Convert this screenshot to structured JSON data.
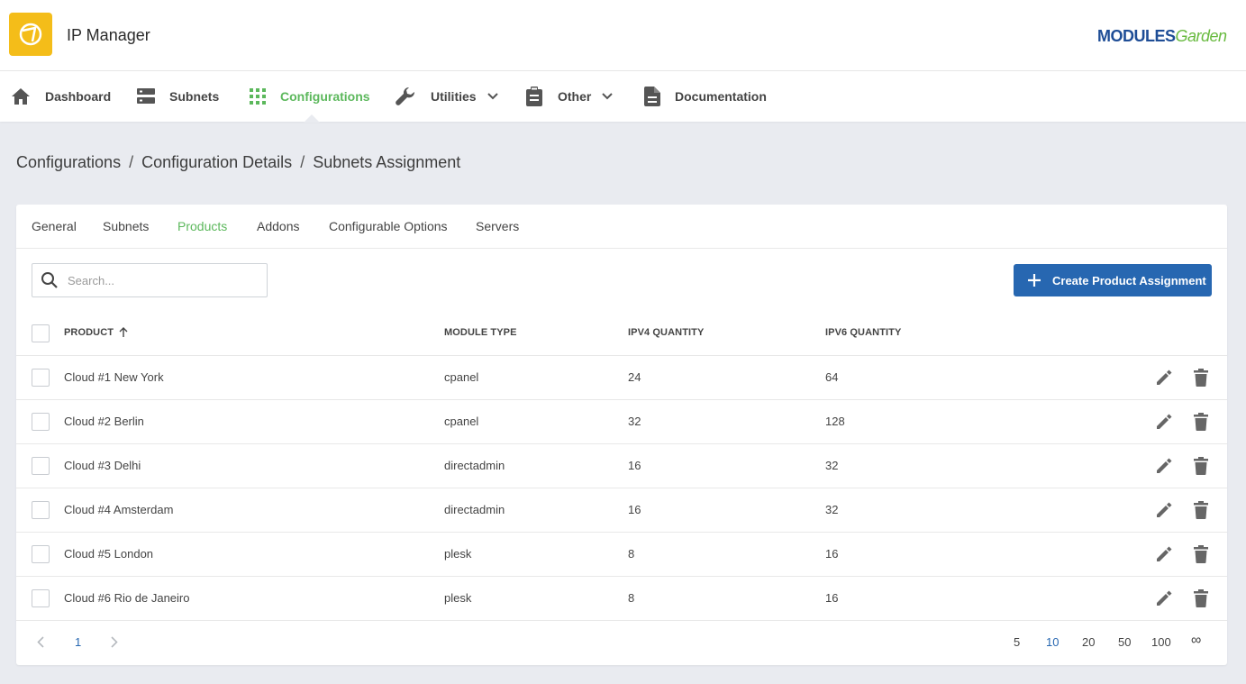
{
  "app": {
    "title": "IP Manager",
    "brand_bold": "MODULES",
    "brand_light": "Garden"
  },
  "nav": {
    "dashboard": "Dashboard",
    "subnets": "Subnets",
    "configurations": "Configurations",
    "utilities": "Utilities",
    "other": "Other",
    "documentation": "Documentation"
  },
  "breadcrumb": {
    "c1": "Configurations",
    "c2": "Configuration Details",
    "c3": "Subnets Assignment",
    "sep": "/"
  },
  "tabs": {
    "general": "General",
    "subnets": "Subnets",
    "products": "Products",
    "addons": "Addons",
    "configurable_options": "Configurable Options",
    "servers": "Servers"
  },
  "search": {
    "placeholder": "Search..."
  },
  "create_button": "Create Product Assignment",
  "table": {
    "headers": {
      "product": "PRODUCT",
      "module_type": "MODULE TYPE",
      "ipv4": "IPV4 QUANTITY",
      "ipv6": "IPV6 QUANTITY"
    },
    "rows": [
      {
        "product": "Cloud #1 New York",
        "module_type": "cpanel",
        "ipv4": "24",
        "ipv6": "64"
      },
      {
        "product": "Cloud #2 Berlin",
        "module_type": "cpanel",
        "ipv4": "32",
        "ipv6": "128"
      },
      {
        "product": "Cloud #3 Delhi",
        "module_type": "directadmin",
        "ipv4": "16",
        "ipv6": "32"
      },
      {
        "product": "Cloud #4 Amsterdam",
        "module_type": "directadmin",
        "ipv4": "16",
        "ipv6": "32"
      },
      {
        "product": "Cloud #5 London",
        "module_type": "plesk",
        "ipv4": "8",
        "ipv6": "16"
      },
      {
        "product": "Cloud #6 Rio de Janeiro",
        "module_type": "plesk",
        "ipv4": "8",
        "ipv6": "16"
      }
    ]
  },
  "pagination": {
    "current_page": "1",
    "per_page": {
      "p5": "5",
      "p10": "10",
      "p20": "20",
      "p50": "50",
      "p100": "100",
      "all": "∞"
    },
    "selected_per_page": "10"
  },
  "colors": {
    "accent_green": "#5cb85c",
    "primary_blue": "#2767b1",
    "app_icon_yellow": "#f4bd19"
  }
}
